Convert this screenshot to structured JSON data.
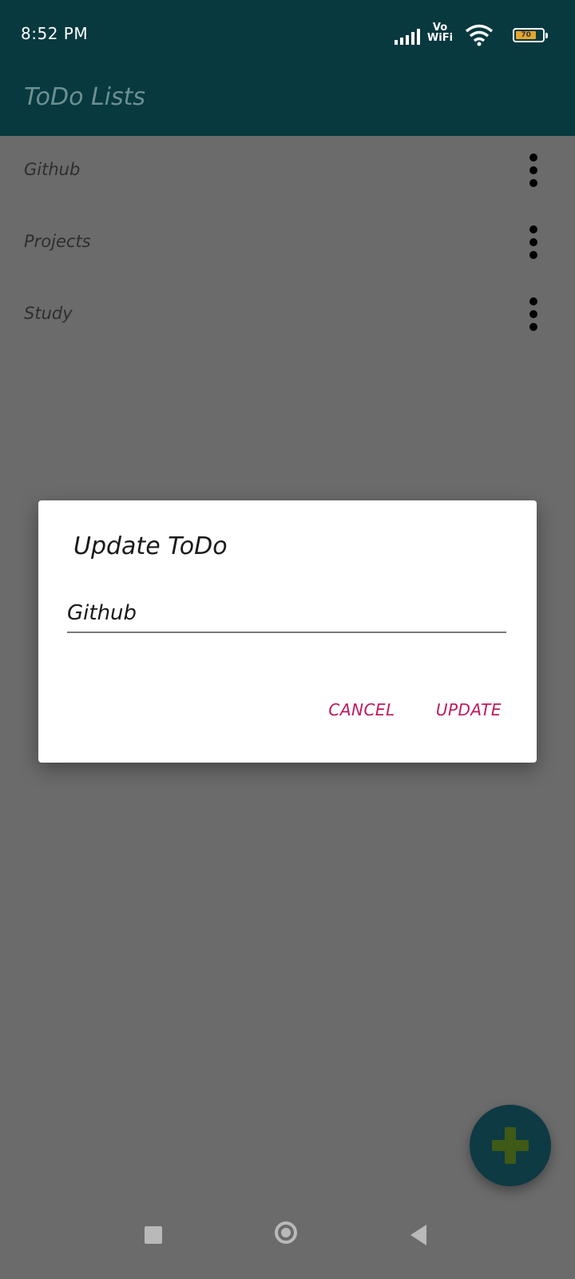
{
  "status_bar": {
    "time": "8:52 PM",
    "network_label": "Vo\nWiFi",
    "battery_level": "70",
    "icons": [
      "signal-icon",
      "vowifi-icon",
      "wifi-icon",
      "battery-icon"
    ]
  },
  "app_bar": {
    "title": "ToDo Lists"
  },
  "list": {
    "items": [
      {
        "label": "Github"
      },
      {
        "label": "Projects"
      },
      {
        "label": "Study"
      }
    ]
  },
  "dialog": {
    "title": "Update ToDo",
    "input_value": "Github",
    "cancel_label": "CANCEL",
    "update_label": "UPDATE"
  },
  "fab": {
    "icon": "plus-icon"
  },
  "nav_bar": {
    "icons": [
      "recents-icon",
      "home-icon",
      "back-icon"
    ]
  },
  "colors": {
    "app_bar": "#07393f",
    "dialog_button": "#c2185b",
    "fab_plus": "#3e5a16",
    "scrim": "#6b6b6b"
  }
}
